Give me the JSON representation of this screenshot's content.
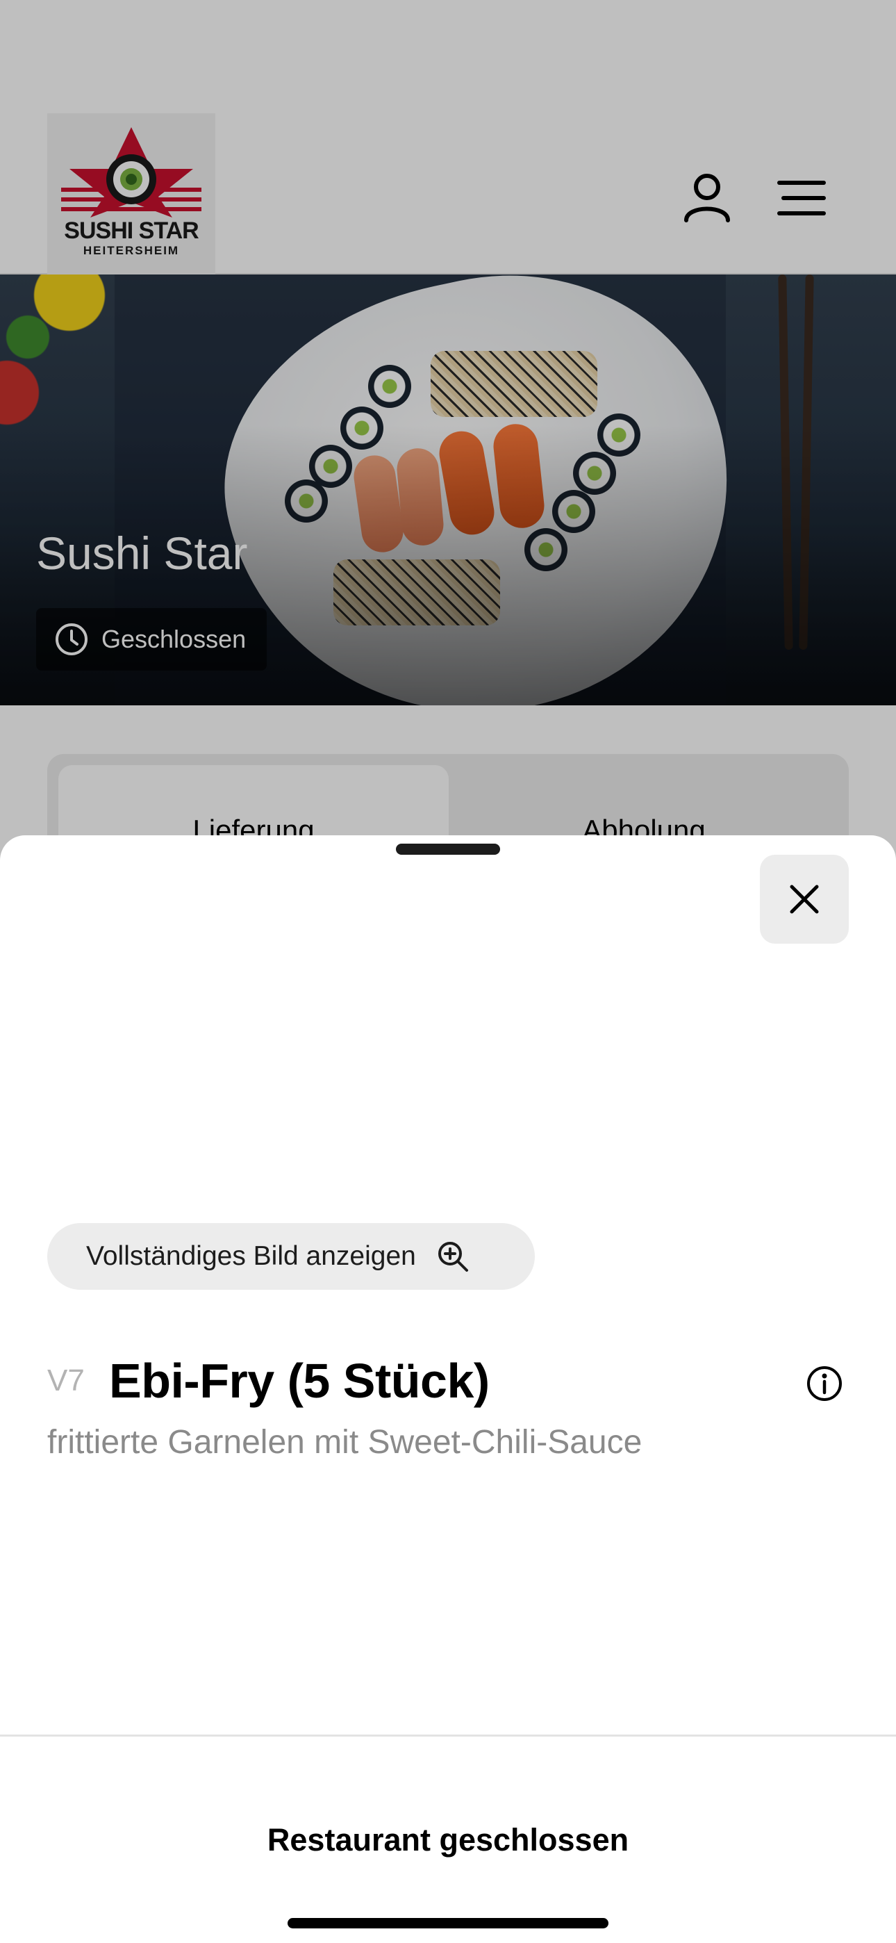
{
  "header": {
    "logo_line_1": "SUSHI STAR",
    "logo_line_2": "HEITERSHEIM",
    "icons": [
      "user-icon",
      "menu-icon"
    ]
  },
  "hero": {
    "title": "Sushi Star",
    "status": "Geschlossen",
    "status_icon": "clock-icon"
  },
  "order_toggle": {
    "options": [
      "Lieferung",
      "Abholung"
    ],
    "selected": "Lieferung"
  },
  "sheet": {
    "close_icon": "close-icon",
    "full_image_button": "Vollständiges Bild anzeigen",
    "zoom_icon": "zoom-in-icon",
    "item": {
      "code": "V7",
      "name": "Ebi-Fry (5 Stück)",
      "description": "frittierte Garnelen mit Sweet-Chili-Sauce",
      "info_icon": "info-icon"
    },
    "footer_label": "Restaurant geschlossen"
  },
  "colors": {
    "overlay": "#000000",
    "logo_red": "#c8102e",
    "logo_green": "#7cb342",
    "sheet_bg": "#ffffff",
    "button_bg": "#ececec"
  }
}
